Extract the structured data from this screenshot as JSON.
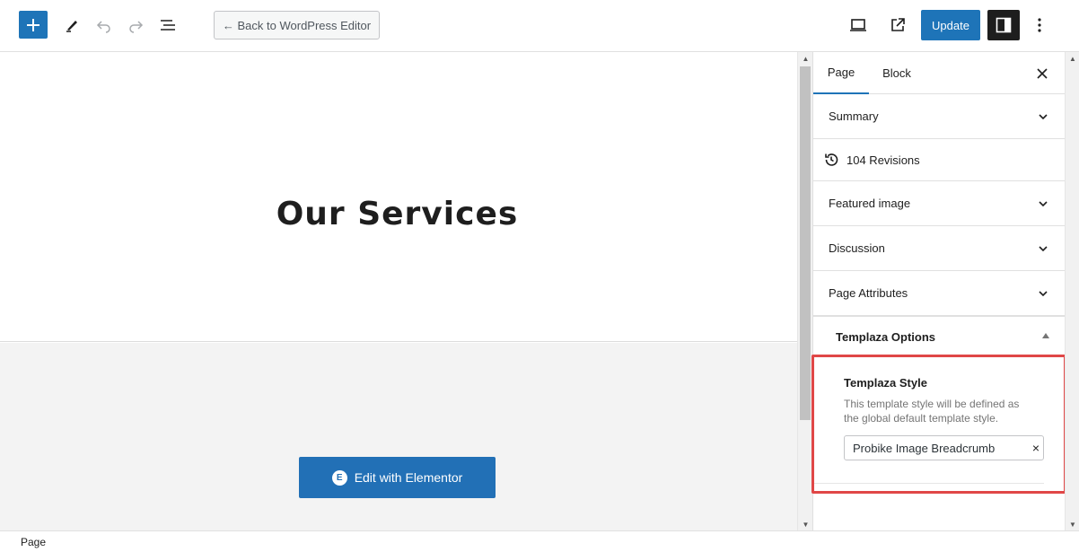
{
  "toolbar": {
    "add_icon": "plus-icon",
    "tools_icon": "pencil-icon",
    "undo_icon": "undo-icon",
    "redo_icon": "redo-icon",
    "list_view_icon": "list-view-icon",
    "back_label": "← Back to WordPress Editor",
    "preview_icon": "laptop-icon",
    "view_icon": "external-link-icon",
    "update_label": "Update",
    "settings_icon": "sidebar-toggle-icon",
    "options_icon": "more-vertical-icon",
    "accent_color": "#1e74b8"
  },
  "canvas": {
    "hero_title": "Our Services",
    "elementor_button_label": "Edit with Elementor",
    "elementor_logo_glyph": "E"
  },
  "sidebar": {
    "tabs": [
      {
        "label": "Page",
        "active": true
      },
      {
        "label": "Block",
        "active": false
      }
    ],
    "close_icon": "close-icon",
    "panels": [
      {
        "label": "Summary"
      },
      {
        "label": "104 Revisions"
      },
      {
        "label": "Featured image"
      },
      {
        "label": "Discussion"
      },
      {
        "label": "Page Attributes"
      }
    ],
    "templaza": {
      "header": "Templaza Options",
      "style_title": "Templaza Style",
      "style_description": "This template style will be defined as the global default template style.",
      "selected_value": "Probike Image Breadcrumb",
      "clear_glyph": "×"
    }
  },
  "footer": {
    "breadcrumb": "Page"
  },
  "colors": {
    "highlight": "#e04747",
    "button_blue": "#2270b6"
  }
}
